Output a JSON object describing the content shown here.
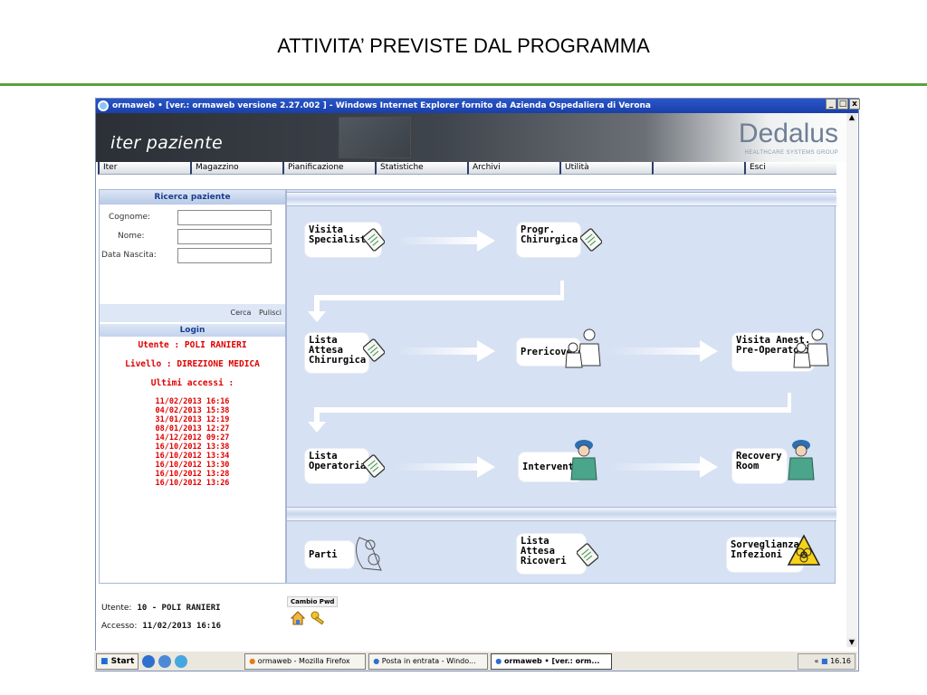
{
  "slide": {
    "title": "ATTIVITA’ PREVISTE DAL PROGRAMMA"
  },
  "window": {
    "title": "ormaweb • [ver.: ormaweb versione 2.27.002 ] - Windows Internet Explorer fornito da Azienda Ospedaliera di Verona",
    "controls": [
      "_",
      "□",
      "x"
    ]
  },
  "header": {
    "app_name": "iter paziente",
    "logo": "Dedalus",
    "logo_sub": "HEALTHCARE SYSTEMS GROUP"
  },
  "menu": {
    "items": [
      "Iter",
      "Magazzino",
      "Pianificazione",
      "Statistiche",
      "Archivi",
      "Utilità",
      "",
      "Esci"
    ]
  },
  "search": {
    "heading": "Ricerca paziente",
    "fields": [
      {
        "label": "Cognome:",
        "value": ""
      },
      {
        "label": "Nome:",
        "value": ""
      },
      {
        "label": "Data Nascita:",
        "value": ""
      }
    ],
    "cerca": "Cerca",
    "pulisci": "Pulisci"
  },
  "login": {
    "heading": "Login",
    "utente": "Utente : POLI RANIERI",
    "livello": "Livello : DIREZIONE MEDICA",
    "ultimi_label": "Ultimi accessi :",
    "accessi": [
      "11/02/2013 16:16",
      "04/02/2013 15:38",
      "31/01/2013 12:19",
      "08/01/2013 12:27",
      "14/12/2012 09:27",
      "16/10/2012 13:38",
      "16/10/2012 13:34",
      "16/10/2012 13:30",
      "16/10/2012 13:28",
      "16/10/2012 13:26"
    ]
  },
  "footer_info": {
    "utente_label": "Utente:",
    "utente_value": "10 - POLI RANIERI",
    "accesso_label": "Accesso:",
    "accesso_value": "11/02/2013 16:16",
    "cambio_pwd": "Cambio Pwd"
  },
  "workflow": {
    "visita_specialistica": "Visita\nSpecialistica",
    "progr_chirurgica": "Progr.\nChirurgica",
    "lista_attesa_chirurgica": "Lista\nAttesa\nChirurgica",
    "prericovero": "Prericovero",
    "visita_anest": "Visita Anest.\nPre-Operatoria",
    "lista_operatoria": "Lista\nOperatoria",
    "interventi": "Interventi",
    "recovery_room": "Recovery\nRoom",
    "parti": "Parti",
    "lista_attesa_ricoveri": "Lista\nAttesa\nRicoveri",
    "sorveglianza_infezioni": "Sorveglianza\nInfezioni"
  },
  "taskbar": {
    "start": "Start",
    "tasks": [
      "ormaweb - Mozilla Firefox",
      "Posta in entrata - Windo...",
      "ormaweb • [ver.: orm..."
    ],
    "tray_prefix": "«",
    "clock": "16.16"
  },
  "colors": {
    "accent_green": "#5aa13c",
    "panel_blue": "#d6e1f3",
    "login_red": "#e00000",
    "heading_blue": "#1a3d8f"
  }
}
